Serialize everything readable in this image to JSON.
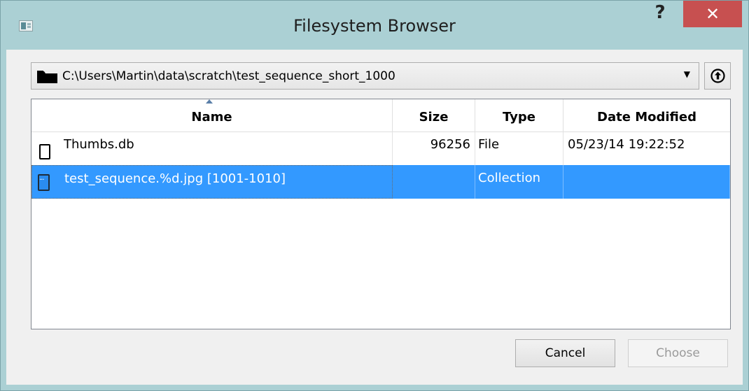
{
  "window": {
    "title": "Filesystem Browser",
    "help_label": "?",
    "close_label": "✕"
  },
  "path_bar": {
    "current_path": "C:\\Users\\Martin\\data\\scratch\\test_sequence_short_1000",
    "dropdown_arrow": "▼",
    "icon": "folder-icon",
    "up_icon": "up-arrow-circle-icon"
  },
  "list": {
    "columns": [
      "Name",
      "Size",
      "Type",
      "Date Modified"
    ],
    "sort_column": "Name",
    "rows": [
      {
        "name": "Thumbs.db",
        "size": "96256",
        "type": "File",
        "date": "05/23/14 19:22:52",
        "icon": "file-icon",
        "selected": false
      },
      {
        "name": "test_sequence.%d.jpg [1001-1010]",
        "size": "",
        "type": "Collection",
        "date": "",
        "icon": "collection-icon",
        "selected": true
      }
    ]
  },
  "buttons": {
    "cancel": "Cancel",
    "choose": "Choose"
  },
  "colors": {
    "titlebar": "#abd0d4",
    "close_button": "#c75050",
    "selection": "#3399ff"
  }
}
